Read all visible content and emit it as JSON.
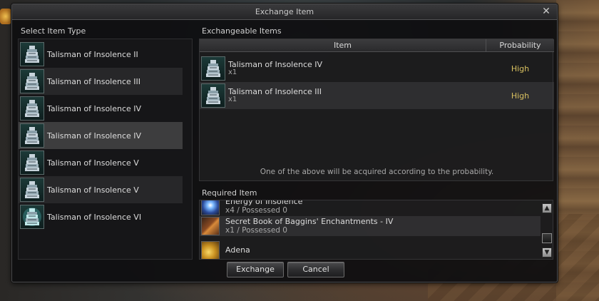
{
  "window": {
    "title": "Exchange Item",
    "close_label": "✕"
  },
  "left": {
    "title": "Select Item Type",
    "items": [
      {
        "label": "Talisman of Insolence II",
        "icon": "talisman-icon"
      },
      {
        "label": "Talisman of Insolence III",
        "icon": "talisman-icon"
      },
      {
        "label": "Talisman of Insolence IV",
        "icon": "talisman-icon"
      },
      {
        "label": "Talisman of Insolence IV",
        "icon": "talisman-icon",
        "selected": true
      },
      {
        "label": "Talisman of Insolence V",
        "icon": "talisman-icon"
      },
      {
        "label": "Talisman of Insolence V",
        "icon": "talisman-icon"
      },
      {
        "label": "Talisman of Insolence VI",
        "icon": "talisman-glow-icon"
      }
    ]
  },
  "exchangeable": {
    "title": "Exchangeable Items",
    "col_item": "Item",
    "col_probability": "Probability",
    "rows": [
      {
        "name": "Talisman of Insolence IV",
        "qty": "x1",
        "probability": "High",
        "icon": "talisman-icon"
      },
      {
        "name": "Talisman of Insolence III",
        "qty": "x1",
        "probability": "High",
        "icon": "talisman-icon"
      }
    ],
    "note": "One of the above will be acquired according to the probability."
  },
  "required": {
    "title": "Required Item",
    "rows": [
      {
        "name": "Energy of Insolence",
        "qty": "x4 / Possessed 0",
        "icon": "energy-orb-icon"
      },
      {
        "name": "Secret Book of Baggins' Enchantments - IV",
        "qty": "x1 / Possessed 0",
        "icon": "scroll-book-icon"
      },
      {
        "name": "Adena",
        "qty": "",
        "icon": "adena-coin-icon"
      }
    ]
  },
  "buttons": {
    "exchange": "Exchange",
    "cancel": "Cancel"
  },
  "colors": {
    "probability_high": "#d8c060",
    "window_bg": "#0e0e10"
  }
}
